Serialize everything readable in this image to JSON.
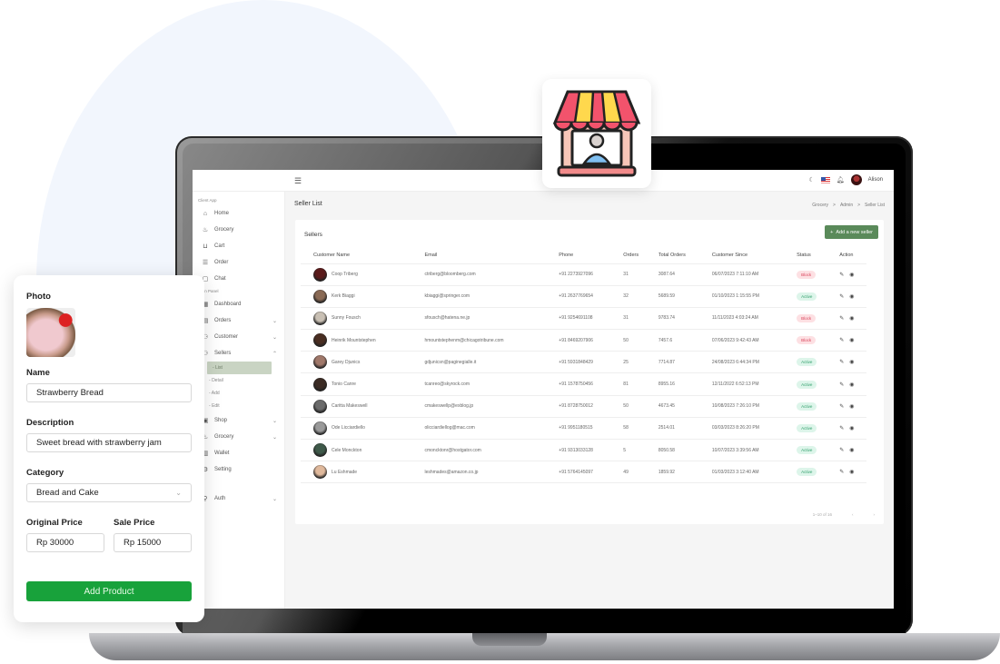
{
  "topbar": {
    "user_name": "Alison"
  },
  "sidebar": {
    "section_client": "Client App",
    "client_items": [
      {
        "label": "Home",
        "icon": "home-icon"
      },
      {
        "label": "Grocery",
        "icon": "basket-icon"
      },
      {
        "label": "Cart",
        "icon": "cart-icon"
      },
      {
        "label": "Order",
        "icon": "list-icon"
      },
      {
        "label": "Chat",
        "icon": "chat-icon"
      }
    ],
    "section_admin": "Main Panel",
    "admin_items": [
      {
        "label": "Dashboard"
      },
      {
        "label": "Orders"
      },
      {
        "label": "Customer"
      },
      {
        "label": "Sellers"
      }
    ],
    "seller_sub": [
      "List",
      "Detail",
      "Add",
      "Edit"
    ],
    "more_items": [
      {
        "label": "Shop"
      },
      {
        "label": "Grocery"
      },
      {
        "label": "Wallet"
      },
      {
        "label": "Setting"
      },
      {
        "label": "Auth"
      }
    ]
  },
  "page": {
    "title": "Seller List",
    "breadcrumb": [
      "Grocery",
      "Admin",
      "Seller List"
    ],
    "breadcrumb_sep": ">"
  },
  "card": {
    "title": "Sellers",
    "add_button": "Add a new seller",
    "columns": [
      "Customer Name",
      "Email",
      "Phone",
      "Orders",
      "Total Orders",
      "Customer Since",
      "Status",
      "Action"
    ],
    "rows": [
      {
        "name": "Coop Triberg",
        "email": "ctriberg@bloomberg.com",
        "phone": "+91 2273927096",
        "orders": "31",
        "total": "3087.64",
        "since": "06/07/2023 7:11:10 AM",
        "status": "Block"
      },
      {
        "name": "Kerk Biaggi",
        "email": "kbiaggi@springer.com",
        "phone": "+91 2637769654",
        "orders": "32",
        "total": "5689.59",
        "since": "01/10/2023 1:15:55 PM",
        "status": "Active"
      },
      {
        "name": "Sunny Fousch",
        "email": "sfousch@hatena.ne.jp",
        "phone": "+91 9254691108",
        "orders": "31",
        "total": "9783.74",
        "since": "11/11/2023 4:03:24 AM",
        "status": "Block"
      },
      {
        "name": "Heinrik Mountstephen",
        "email": "hmountstephenm@chicagotribune.com",
        "phone": "+91 8469207906",
        "orders": "50",
        "total": "7457.6",
        "since": "07/06/2023 9:42:43 AM",
        "status": "Block"
      },
      {
        "name": "Garey Djunics",
        "email": "gdjunicsn@paginegialle.it",
        "phone": "+91 5931848429",
        "orders": "25",
        "total": "7714.87",
        "since": "24/08/2023 6:44:34 PM",
        "status": "Active"
      },
      {
        "name": "Tonio Canre",
        "email": "tcanreo@skyrock.com",
        "phone": "+91 1578750456",
        "orders": "81",
        "total": "8955.16",
        "since": "12/11/2022 6:52:13 PM",
        "status": "Active"
      },
      {
        "name": "Caritta Makeswell",
        "email": "cmakeswellp@exblog.jp",
        "phone": "+91 8728750012",
        "orders": "50",
        "total": "4673.45",
        "since": "10/08/2023 7:26:10 PM",
        "status": "Active"
      },
      {
        "name": "Ode Licciardiello",
        "email": "olicciardiellog@mac.com",
        "phone": "+91 9951180515",
        "orders": "58",
        "total": "2514.01",
        "since": "03/03/2023 8:26:20 PM",
        "status": "Active"
      },
      {
        "name": "Cele Monckton",
        "email": "cmoncktonr@hostgator.com",
        "phone": "+91 9313033128",
        "orders": "5",
        "total": "8050.58",
        "since": "10/07/2023 3:39:56 AM",
        "status": "Active"
      },
      {
        "name": "Lu Eshmade",
        "email": "leshmades@amazon.co.jp",
        "phone": "+91 5764145097",
        "orders": "49",
        "total": "1859.92",
        "since": "01/03/2023 3:12:40 AM",
        "status": "Active"
      }
    ],
    "pagination": "1–10 of 16",
    "prev": "‹",
    "next": "›"
  },
  "form": {
    "photo_label": "Photo",
    "name_label": "Name",
    "name_value": "Strawberry Bread",
    "description_label": "Description",
    "description_value": "Sweet bread with strawberry jam",
    "category_label": "Category",
    "category_value": "Bread and Cake",
    "original_price_label": "Original Price",
    "original_price_value": "Rp  30000",
    "sale_price_label": "Sale Price",
    "sale_price_value": "Rp  15000",
    "submit_label": "Add Product"
  },
  "colors": {
    "primary_green": "#18a23b",
    "seller_button": "#5a8a5a",
    "active_badge": "#2f9e6a",
    "block_badge": "#d9435a"
  }
}
